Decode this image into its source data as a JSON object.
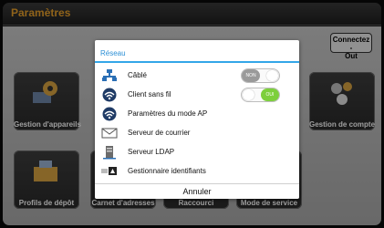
{
  "title_bar": {
    "title": "Paramètres"
  },
  "header": {
    "connect_label_line1": "Connectez -",
    "connect_label_line2": "Out"
  },
  "tiles": [
    {
      "label": "Gestion d'appareils",
      "icon": "device-gear-icon"
    },
    {
      "label": "Gestion de compte",
      "icon": "account-gear-icon"
    },
    {
      "label": "Profils de dépôt",
      "icon": "folder-profile-icon"
    },
    {
      "label": "Carnet d'adresses",
      "icon": "address-book-icon"
    },
    {
      "label": "Raccourci",
      "icon": "shortcut-icon"
    },
    {
      "label": "Mode de service",
      "icon": "service-icon"
    }
  ],
  "dialog": {
    "title": "Réseau",
    "items": [
      {
        "label": "Câblé",
        "icon": "wired-network-icon",
        "toggle": "NON"
      },
      {
        "label": "Client sans fil",
        "icon": "wireless-client-icon",
        "toggle": "OUI"
      },
      {
        "label": "Paramètres du mode AP",
        "icon": "access-point-icon"
      },
      {
        "label": "Serveur de courrier",
        "icon": "mail-server-icon"
      },
      {
        "label": "Serveur LDAP",
        "icon": "ldap-server-icon"
      },
      {
        "label": "Gestionnaire identifiants",
        "icon": "credentials-icon"
      }
    ],
    "cancel_label": "Annuler"
  },
  "colors": {
    "title": "#e8a02a",
    "accent": "#33a6e8",
    "toggle_on": "#7dcf3c"
  }
}
